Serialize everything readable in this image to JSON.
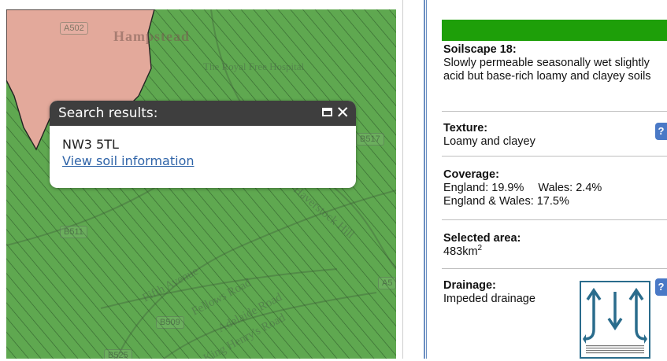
{
  "map": {
    "place_label": "Hampstead",
    "hospital_label": "The Royal Free Hospital",
    "roads": [
      "Fifth Avenue",
      "Fellows Road",
      "Adelaide Road",
      "King Henry's Road",
      "Haverstock Hill"
    ],
    "shields": [
      "A502",
      "B517",
      "B511",
      "B509",
      "A5",
      "B525"
    ],
    "colors": {
      "soil_green": "#5fa850",
      "urban_pink": "#e3a99b",
      "hatch": "#2f5a2a"
    }
  },
  "popup": {
    "title": "Search results:",
    "maximize_icon": "maximize-icon",
    "close_icon": "close-icon",
    "close_glyph": "✕",
    "postcode": "NW3 5TL",
    "link_label": "View soil information"
  },
  "panel": {
    "accent_color": "#1e9f09",
    "soilscape_heading": "Soilscape 18:",
    "soilscape_desc": "Slowly permeable seasonally wet slightly acid but base-rich loamy and clayey soils",
    "texture_heading": "Texture:",
    "texture_value": "Loamy and clayey",
    "coverage_heading": "Coverage:",
    "coverage_line1_england": "England: 19.9%",
    "coverage_line1_wales": "Wales: 2.4%",
    "coverage_line2": "England & Wales: 17.5%",
    "area_heading": "Selected area:",
    "area_value": "483km",
    "area_unit_sup": "2",
    "drainage_heading": "Drainage:",
    "drainage_value": "Impeded drainage",
    "help_glyph": "?"
  }
}
